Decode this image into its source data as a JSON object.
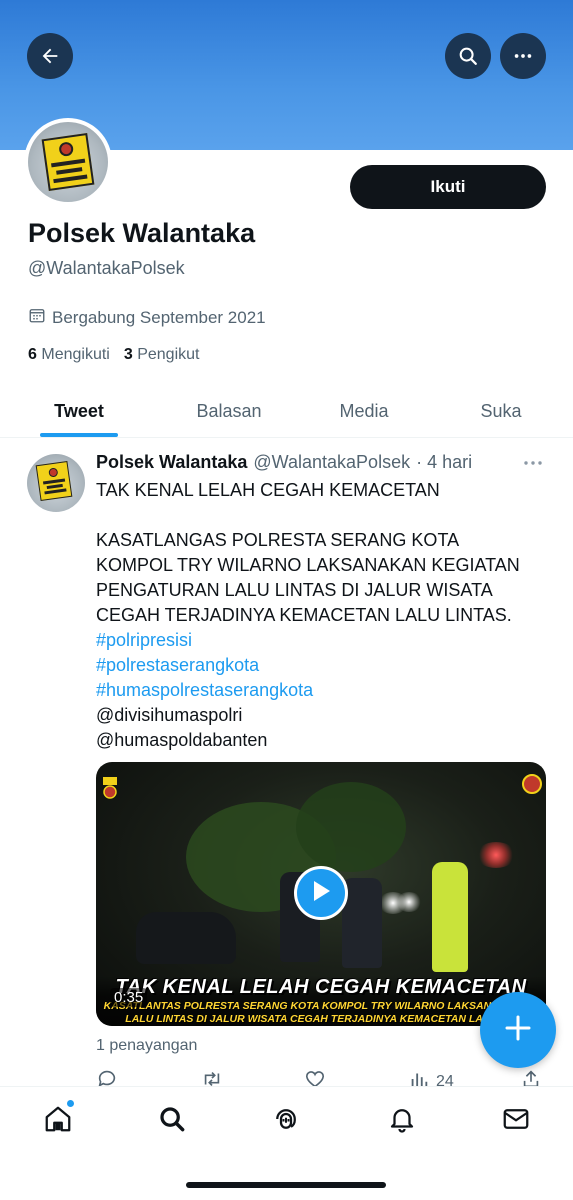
{
  "header": {
    "back_icon": "arrow-left-icon",
    "search_icon": "search-icon",
    "more_icon": "more-horizontal-icon",
    "banner_color": "#3f8fe2"
  },
  "profile": {
    "follow_label": "Ikuti",
    "name": "Polsek Walantaka",
    "handle": "@WalantakaPolsek",
    "joined": "Bergabung September 2021",
    "following_count": "6",
    "following_label": "Mengikuti",
    "followers_count": "3",
    "followers_label": "Pengikut"
  },
  "tabs": [
    {
      "label": "Tweet",
      "active": true
    },
    {
      "label": "Balasan",
      "active": false
    },
    {
      "label": "Media",
      "active": false
    },
    {
      "label": "Suka",
      "active": false
    }
  ],
  "tweet": {
    "author_name": "Polsek Walantaka",
    "author_handle": "@WalantakaPolsek",
    "time": "· 4 hari",
    "lines": [
      "TAK KENAL LELAH CEGAH KEMACETAN",
      "",
      "KASATLANGAS POLRESTA SERANG KOTA",
      "KOMPOL TRY WILARNO LAKSANAKAN KEGIATAN",
      "PENGATURAN LALU LINTAS DI JALUR WISATA",
      "CEGAH TERJADINYA KEMACETAN LALU LINTAS."
    ],
    "hashtags": [
      "#polripresisi",
      "#polrestaserangkota",
      "#humaspolrestaserangkota"
    ],
    "mentions": [
      "@divisihumaspolri",
      "@humaspoldabanten"
    ],
    "video": {
      "duration": "0:35",
      "caption_title": "TAK KENAL LELAH CEGAH KEMACETAN",
      "caption_line1": "KASATLANTAS POLRESTA SERANG KOTA KOMPOL TRY WILARNO LAKSANAKAN PE",
      "caption_line2": "LALU LINTAS DI JALUR WISATA CEGAH TERJADINYA KEMACETAN LALU LIN"
    },
    "views": "1 penayangan",
    "stats": {
      "analytics": "24"
    }
  },
  "accent_color": "#1d9bf0",
  "nav": [
    "home-icon",
    "search-icon",
    "spaces-icon",
    "notifications-icon",
    "messages-icon"
  ]
}
